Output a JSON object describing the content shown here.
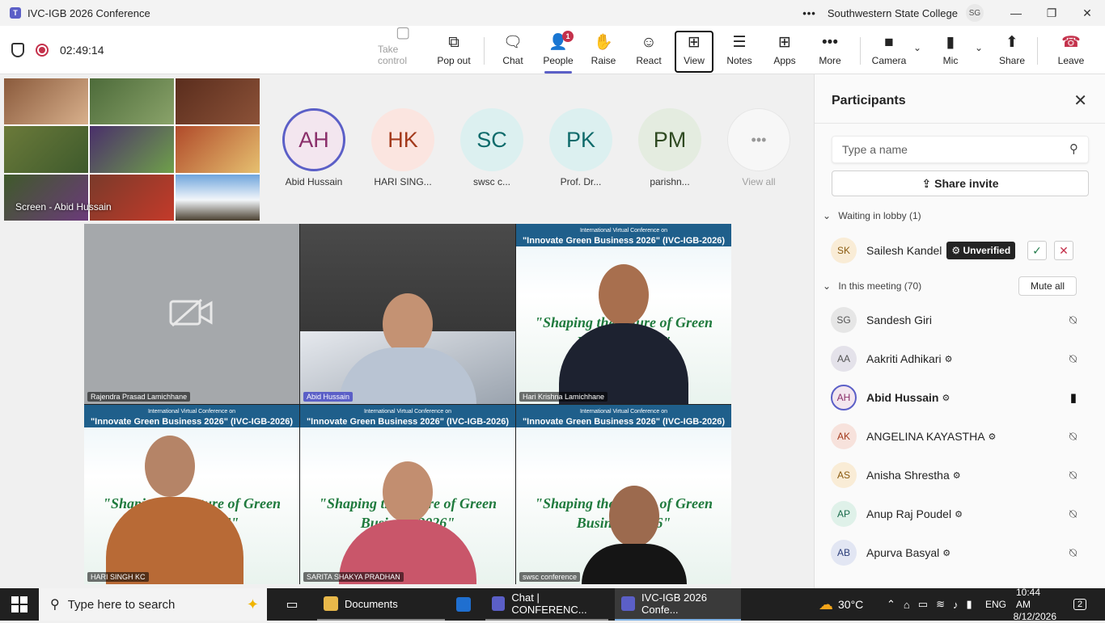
{
  "window": {
    "title": "IVC-IGB 2026 Conference",
    "org": "Southwestern State College",
    "user_initials": "SG",
    "more": "•••",
    "minimize": "—",
    "maximize": "❐",
    "close": "✕"
  },
  "toolbar": {
    "timer": "02:49:14",
    "buttons": {
      "take_control": "Take control",
      "pop_out": "Pop out",
      "chat": "Chat",
      "people": "People",
      "people_badge": "1",
      "raise": "Raise",
      "react": "React",
      "view": "View",
      "notes": "Notes",
      "apps": "Apps",
      "more": "More",
      "camera": "Camera",
      "mic": "Mic",
      "share": "Share",
      "leave": "Leave"
    },
    "icons": {
      "take_control": "▢",
      "pop_out": "⧉",
      "chat": "🗨",
      "people": "👤",
      "raise": "✋",
      "react": "☺",
      "view": "⊞",
      "notes": "☰",
      "apps": "⊞",
      "more": "•••",
      "camera": "■",
      "mic": "▮",
      "share": "⬆",
      "leave": "☎",
      "chevron": "⌄"
    }
  },
  "stage": {
    "screen_label": "Screen - Abid Hussain",
    "gallery": [
      {
        "initials": "AH",
        "name": "Abid Hussain"
      },
      {
        "initials": "HK",
        "name": "HARI SING..."
      },
      {
        "initials": "SC",
        "name": "swsc c..."
      },
      {
        "initials": "PK",
        "name": "Prof. Dr..."
      },
      {
        "initials": "PM",
        "name": "parishn..."
      }
    ],
    "view_all": "View all",
    "view_all_icon": "•••",
    "videos": [
      {
        "name": "Rajendra Prasad Lamichhane"
      },
      {
        "name": "Abid Hussain"
      },
      {
        "name": "Hari Krishna Lamichhane"
      },
      {
        "name": "HARI SINGH KC"
      },
      {
        "name": "SARITA SHAKYA PRADHAN"
      },
      {
        "name": "swsc conference"
      }
    ],
    "poster": {
      "subtitle": "International Virtual Conference on",
      "heading": "\"Innovate Green Business 2026\" (IVC-IGB-2026)",
      "slogan_1": "\"Shaping the future of Green",
      "slogan_2": "Business 2026\""
    }
  },
  "panel": {
    "title": "Participants",
    "search_placeholder": "Type a name",
    "share_invite": "Share invite",
    "lobby_header": "Waiting in lobby (1)",
    "lobby": {
      "initials": "SK",
      "name": "Sailesh Kandel",
      "badge": "Unverified"
    },
    "meeting_header": "In this meeting (70)",
    "mute_all": "Mute all",
    "participants": [
      {
        "initials": "SG",
        "name": "Sandesh Giri",
        "org": "",
        "bg": "#e6e6e6",
        "fg": "#555555"
      },
      {
        "initials": "AA",
        "name": "Aakriti Adhikari",
        "org": "⚙",
        "bg": "#e4e2ea",
        "fg": "#555555"
      },
      {
        "initials": "AH",
        "name": "Abid Hussain",
        "org": "⚙",
        "bg": "#f3e6ef",
        "fg": "#8a2f6a"
      },
      {
        "initials": "AK",
        "name": "ANGELINA KAYASTHA",
        "org": "⚙",
        "bg": "#f7e2dc",
        "fg": "#a33a1c"
      },
      {
        "initials": "AS",
        "name": "Anisha Shrestha",
        "org": "⚙",
        "bg": "#f9ecd6",
        "fg": "#8a5a10"
      },
      {
        "initials": "AP",
        "name": "Anup Raj Poudel",
        "org": "⚙",
        "bg": "#dff1e9",
        "fg": "#1b6b4c"
      },
      {
        "initials": "AB",
        "name": "Apurva Basyal",
        "org": "⚙",
        "bg": "#e2e6f3",
        "fg": "#2d3f7a"
      }
    ]
  },
  "taskbar": {
    "search_placeholder": "Type here to search",
    "apps": [
      {
        "label": "Documents"
      },
      {
        "label": "Chat | CONFERENC..."
      },
      {
        "label": "IVC-IGB 2026 Confe..."
      }
    ],
    "temperature": "30°C",
    "language": "ENG",
    "time": "10:44 AM",
    "date": "8/12/2026",
    "notifications": "2"
  },
  "colors": {
    "brand": "#5b5fc7",
    "leave_red": "#c4314b",
    "accept_green": "#237b4b",
    "taskbar": "#202020"
  }
}
